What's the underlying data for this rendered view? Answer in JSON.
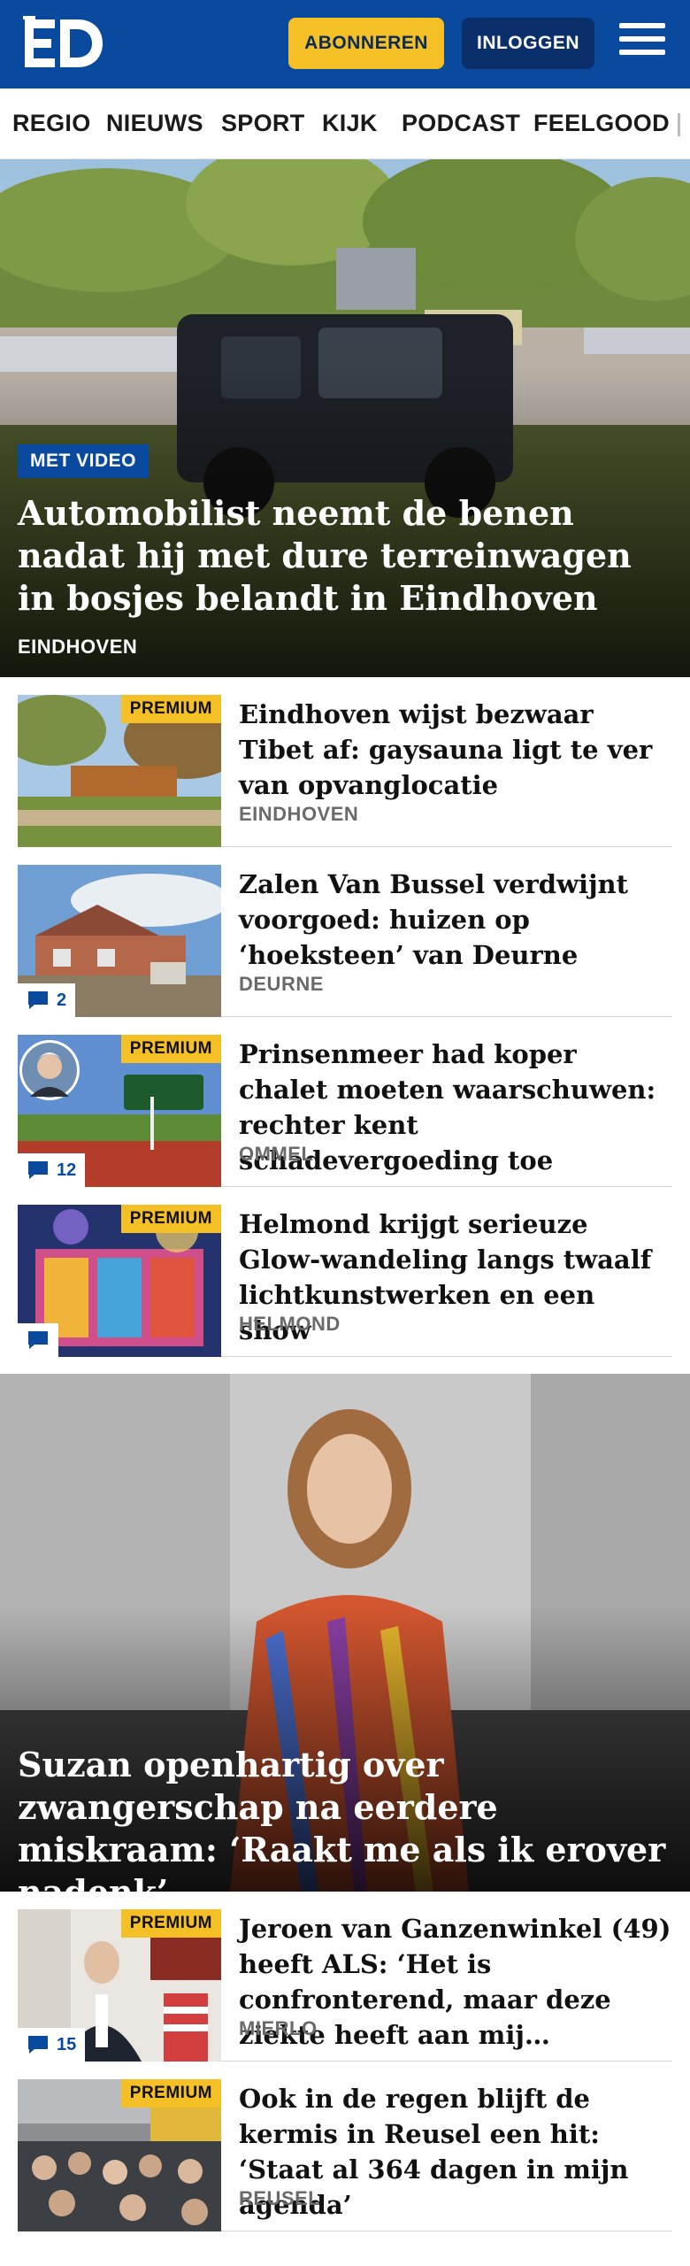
{
  "header": {
    "logo_text": "ED",
    "subscribe_label": "ABONNEREN",
    "login_label": "INLOGGEN"
  },
  "nav": {
    "items": [
      "REGIO",
      "NIEUWS",
      "SPORT",
      "KIJK",
      "PODCAST",
      "FEELGOOD"
    ]
  },
  "hero": {
    "badge": "MET VIDEO",
    "title": "Automobilist neemt de benen nadat hij met dure terreinwagen in bosjes belandt in Eindhoven",
    "location": "EINDHOVEN"
  },
  "articles": [
    {
      "title": "Eindhoven wijst bezwaar Tibet af: gaysauna ligt te ver van opvanglocatie",
      "location": "EINDHOVEN",
      "premium": "PREMIUM",
      "comments": ""
    },
    {
      "title": "Zalen Van Bussel verdwijnt voorgoed: huizen op ‘hoeksteen’ van Deurne",
      "location": "DEURNE",
      "premium": "",
      "comments": "2"
    },
    {
      "title": "Prinsenmeer had koper chalet moeten waarschuwen: rechter kent schadevergoeding toe",
      "location": "OMMEL",
      "premium": "PREMIUM",
      "comments": "12"
    },
    {
      "title": "Helmond krijgt serieuze Glow-wandeling langs twaalf lichtkunstwerken en een show",
      "location": "HELMOND",
      "premium": "PREMIUM",
      "comments": ""
    }
  ],
  "hero2": {
    "title": "Suzan openhartig over zwangerschap na eerdere miskraam: ‘Raakt me als ik erover nadenk’"
  },
  "articles2": [
    {
      "title": "Jeroen van Ganzenwinkel (49) heeft ALS: ‘Het is confronterend, maar deze ziekte heeft aan mij…",
      "location": "MIERLO",
      "premium": "PREMIUM",
      "comments": "15"
    },
    {
      "title": "Ook in de regen blijft de kermis in Reusel een hit: ‘Staat al 364 dagen in mijn agenda’",
      "location": "REUSEL",
      "premium": "PREMIUM",
      "comments": ""
    }
  ],
  "colors": {
    "brand_blue": "#0a4a9e",
    "subscribe_yellow": "#f5c026",
    "login_dark_blue": "#0b2f6b"
  }
}
